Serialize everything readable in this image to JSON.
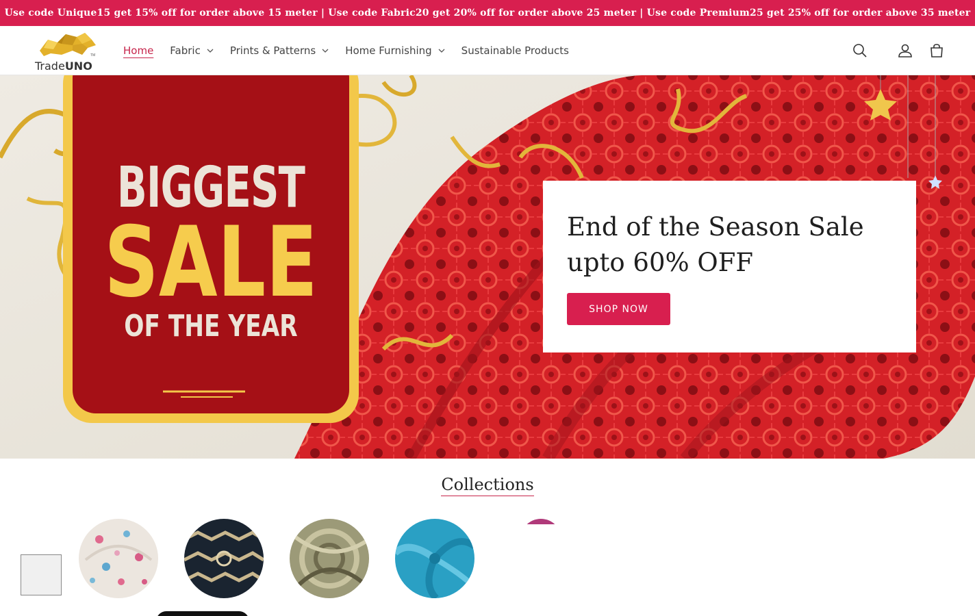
{
  "announcement": "Use code Unique15 get 15% off for order above 15 meter | Use code Fabric20 get 20% off for order above 25 meter | Use code Premium25 get 25% off for order above 35 meter",
  "brand": {
    "name_regular": "Trade",
    "name_bold": "UNO",
    "tm": "TM"
  },
  "nav": [
    {
      "label": "Home",
      "active": true,
      "dropdown": false
    },
    {
      "label": "Fabric",
      "dropdown": true
    },
    {
      "label": "Prints & Patterns",
      "dropdown": true
    },
    {
      "label": "Home Furnishing",
      "dropdown": true
    },
    {
      "label": "Sustainable Products",
      "dropdown": false
    }
  ],
  "header_icons": [
    "search-icon",
    "account-icon",
    "cart-icon"
  ],
  "hero": {
    "tag_line1": "BIGGEST",
    "tag_line2": "SALE",
    "tag_line3": "OF THE YEAR",
    "heading": "End of the Season Sale\nupto 60% OFF",
    "button": "SHOP NOW"
  },
  "collections": {
    "title": "Collections"
  },
  "colors": {
    "accent": "#d81f4f",
    "tag_red": "#a51016",
    "gold": "#f3c84a",
    "lace_red": "#d42127"
  }
}
